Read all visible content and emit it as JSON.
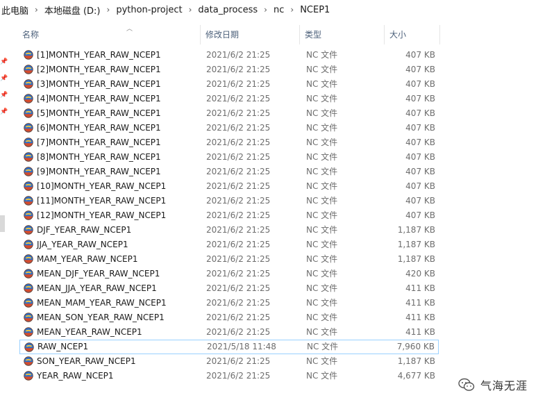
{
  "breadcrumb": [
    "此电脑",
    "本地磁盘 (D:)",
    "python-project",
    "data_process",
    "nc",
    "NCEP1"
  ],
  "columns": {
    "name": "名称",
    "date": "修改日期",
    "type": "类型",
    "size": "大小"
  },
  "files": [
    {
      "name": "[1]MONTH_YEAR_RAW_NCEP1",
      "date": "2021/6/2 21:25",
      "type": "NC 文件",
      "size": "407 KB"
    },
    {
      "name": "[2]MONTH_YEAR_RAW_NCEP1",
      "date": "2021/6/2 21:25",
      "type": "NC 文件",
      "size": "407 KB"
    },
    {
      "name": "[3]MONTH_YEAR_RAW_NCEP1",
      "date": "2021/6/2 21:25",
      "type": "NC 文件",
      "size": "407 KB"
    },
    {
      "name": "[4]MONTH_YEAR_RAW_NCEP1",
      "date": "2021/6/2 21:25",
      "type": "NC 文件",
      "size": "407 KB"
    },
    {
      "name": "[5]MONTH_YEAR_RAW_NCEP1",
      "date": "2021/6/2 21:25",
      "type": "NC 文件",
      "size": "407 KB"
    },
    {
      "name": "[6]MONTH_YEAR_RAW_NCEP1",
      "date": "2021/6/2 21:25",
      "type": "NC 文件",
      "size": "407 KB"
    },
    {
      "name": "[7]MONTH_YEAR_RAW_NCEP1",
      "date": "2021/6/2 21:25",
      "type": "NC 文件",
      "size": "407 KB"
    },
    {
      "name": "[8]MONTH_YEAR_RAW_NCEP1",
      "date": "2021/6/2 21:25",
      "type": "NC 文件",
      "size": "407 KB"
    },
    {
      "name": "[9]MONTH_YEAR_RAW_NCEP1",
      "date": "2021/6/2 21:25",
      "type": "NC 文件",
      "size": "407 KB"
    },
    {
      "name": "[10]MONTH_YEAR_RAW_NCEP1",
      "date": "2021/6/2 21:25",
      "type": "NC 文件",
      "size": "407 KB"
    },
    {
      "name": "[11]MONTH_YEAR_RAW_NCEP1",
      "date": "2021/6/2 21:25",
      "type": "NC 文件",
      "size": "407 KB"
    },
    {
      "name": "[12]MONTH_YEAR_RAW_NCEP1",
      "date": "2021/6/2 21:25",
      "type": "NC 文件",
      "size": "407 KB"
    },
    {
      "name": "DJF_YEAR_RAW_NCEP1",
      "date": "2021/6/2 21:25",
      "type": "NC 文件",
      "size": "1,187 KB"
    },
    {
      "name": "JJA_YEAR_RAW_NCEP1",
      "date": "2021/6/2 21:25",
      "type": "NC 文件",
      "size": "1,187 KB"
    },
    {
      "name": "MAM_YEAR_RAW_NCEP1",
      "date": "2021/6/2 21:25",
      "type": "NC 文件",
      "size": "1,187 KB"
    },
    {
      "name": "MEAN_DJF_YEAR_RAW_NCEP1",
      "date": "2021/6/2 21:25",
      "type": "NC 文件",
      "size": "420 KB"
    },
    {
      "name": "MEAN_JJA_YEAR_RAW_NCEP1",
      "date": "2021/6/2 21:25",
      "type": "NC 文件",
      "size": "411 KB"
    },
    {
      "name": "MEAN_MAM_YEAR_RAW_NCEP1",
      "date": "2021/6/2 21:25",
      "type": "NC 文件",
      "size": "411 KB"
    },
    {
      "name": "MEAN_SON_YEAR_RAW_NCEP1",
      "date": "2021/6/2 21:25",
      "type": "NC 文件",
      "size": "411 KB"
    },
    {
      "name": "MEAN_YEAR_RAW_NCEP1",
      "date": "2021/6/2 21:25",
      "type": "NC 文件",
      "size": "411 KB"
    },
    {
      "name": "RAW_NCEP1",
      "date": "2021/5/18 11:48",
      "type": "NC 文件",
      "size": "7,960 KB",
      "selected": true
    },
    {
      "name": "SON_YEAR_RAW_NCEP1",
      "date": "2021/6/2 21:25",
      "type": "NC 文件",
      "size": "1,187 KB"
    },
    {
      "name": "YEAR_RAW_NCEP1",
      "date": "2021/6/2 21:25",
      "type": "NC 文件",
      "size": "4,677 KB"
    }
  ],
  "icons": {
    "file": "nc-file-icon",
    "pin": "pin-icon",
    "watermark": "wechat-icon"
  },
  "colors": {
    "header_text": "#4c607a",
    "detail_text": "#6d6d6d",
    "selection_border": "#99d1ff"
  },
  "watermark": {
    "text": "气海无涯"
  }
}
